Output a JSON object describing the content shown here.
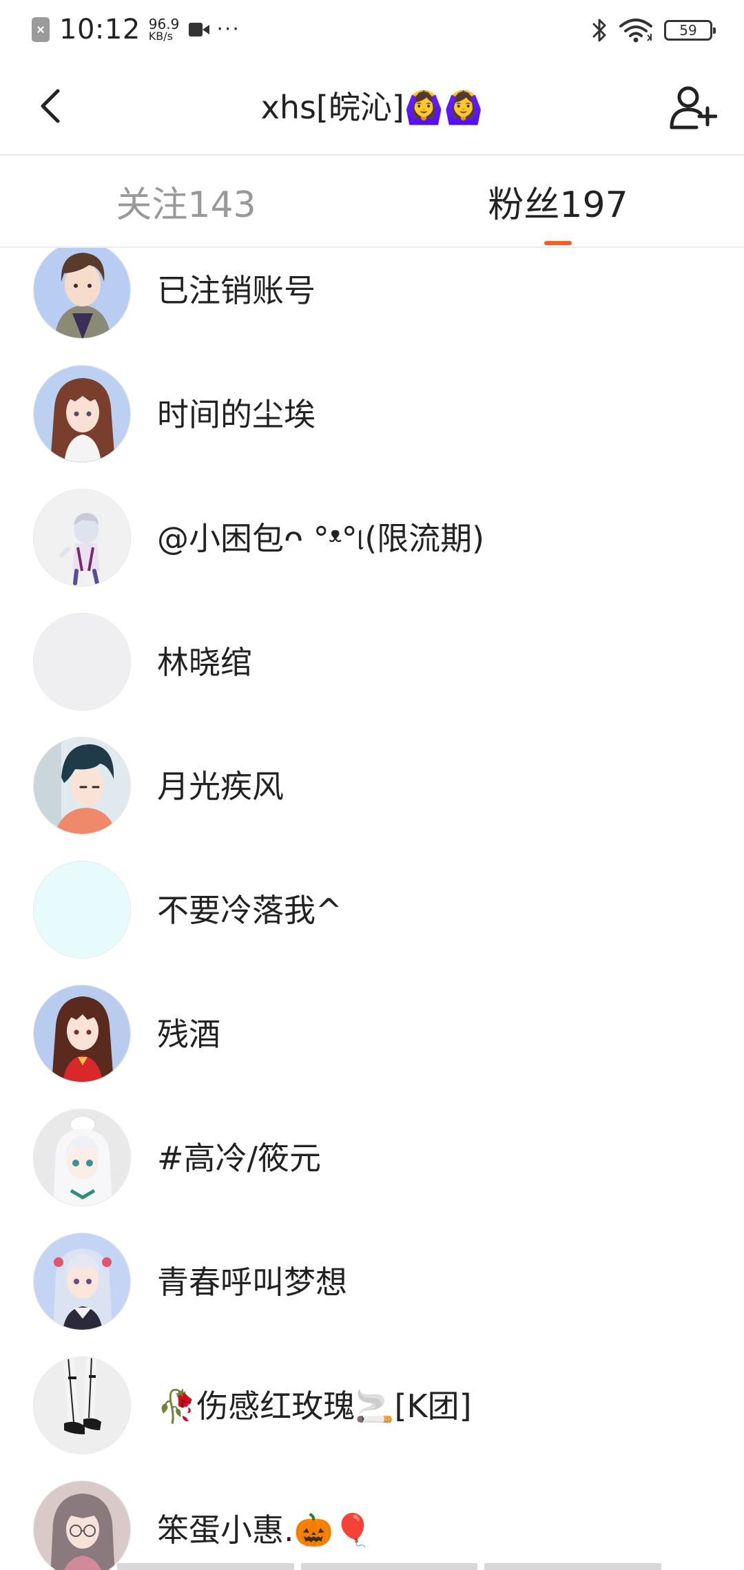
{
  "status_bar": {
    "time": "10:12",
    "net_speed_value": "96.9",
    "net_speed_unit": "KB/s",
    "more": "···",
    "battery_level": "59",
    "icons": [
      "sim-off-icon",
      "video-icon",
      "bluetooth-icon",
      "wifi-icon",
      "battery-icon"
    ]
  },
  "header": {
    "title": "xhs[皖沁]🙆‍♀️🙆‍♀️",
    "back_icon": "chevron-left-icon",
    "add_user_icon": "add-user-icon"
  },
  "tabs": [
    {
      "label": "关注143",
      "active": false
    },
    {
      "label": "粉丝197",
      "active": true
    }
  ],
  "colors": {
    "accent": "#ff5a1f",
    "inactive_tab": "#999999",
    "text": "#222222"
  },
  "followers": [
    {
      "name": "已注销账号",
      "avatar": "anime-boy-avatar",
      "avatar_bg": "#b9cdf2"
    },
    {
      "name": "时间的尘埃",
      "avatar": "anime-girl-avatar",
      "avatar_bg": "#bcd0f2"
    },
    {
      "name": "@小困包ᴖ °ᵜ°୲(限流期)",
      "avatar": "chibi-figure-avatar",
      "avatar_bg": "#f1f1f1"
    },
    {
      "name": "林晓绾",
      "avatar": "blank-avatar",
      "avatar_bg": "#efeff1"
    },
    {
      "name": "月光疾风",
      "avatar": "anime-man-avatar",
      "avatar_bg": "#dfe9ee"
    },
    {
      "name": "不要冷落我^",
      "avatar": "pale-cyan-avatar",
      "avatar_bg": "#e8fbfc"
    },
    {
      "name": "残酒",
      "avatar": "anime-girl-red-avatar",
      "avatar_bg": "#b8ccf0"
    },
    {
      "name": "#高冷/筱元",
      "avatar": "white-hair-girl-avatar",
      "avatar_bg": "#e9e9e9"
    },
    {
      "name": "青春呼叫梦想",
      "avatar": "silver-hair-girl-avatar",
      "avatar_bg": "#c3d4f4"
    },
    {
      "name": "🥀伤感红玫瑰🚬[K团]",
      "avatar": "legs-shoes-avatar",
      "avatar_bg": "#eeeeee"
    },
    {
      "name": "笨蛋小惠.🎃🎈",
      "avatar": "glasses-girl-avatar",
      "avatar_bg": "#d9c9c9"
    }
  ]
}
